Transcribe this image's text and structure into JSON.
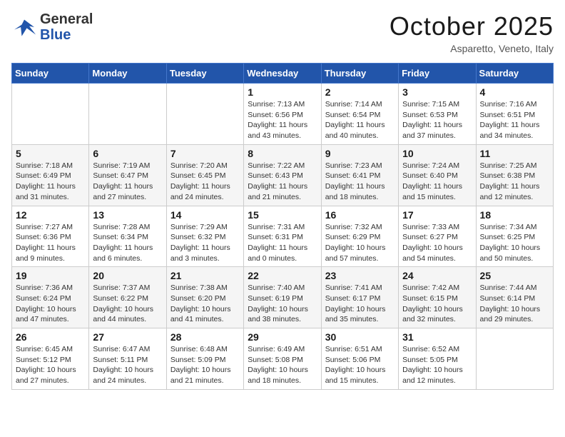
{
  "logo": {
    "general": "General",
    "blue": "Blue"
  },
  "title": "October 2025",
  "subtitle": "Asparetto, Veneto, Italy",
  "weekdays": [
    "Sunday",
    "Monday",
    "Tuesday",
    "Wednesday",
    "Thursday",
    "Friday",
    "Saturday"
  ],
  "weeks": [
    [
      {
        "day": "",
        "info": ""
      },
      {
        "day": "",
        "info": ""
      },
      {
        "day": "",
        "info": ""
      },
      {
        "day": "1",
        "info": "Sunrise: 7:13 AM\nSunset: 6:56 PM\nDaylight: 11 hours and 43 minutes."
      },
      {
        "day": "2",
        "info": "Sunrise: 7:14 AM\nSunset: 6:54 PM\nDaylight: 11 hours and 40 minutes."
      },
      {
        "day": "3",
        "info": "Sunrise: 7:15 AM\nSunset: 6:53 PM\nDaylight: 11 hours and 37 minutes."
      },
      {
        "day": "4",
        "info": "Sunrise: 7:16 AM\nSunset: 6:51 PM\nDaylight: 11 hours and 34 minutes."
      }
    ],
    [
      {
        "day": "5",
        "info": "Sunrise: 7:18 AM\nSunset: 6:49 PM\nDaylight: 11 hours and 31 minutes."
      },
      {
        "day": "6",
        "info": "Sunrise: 7:19 AM\nSunset: 6:47 PM\nDaylight: 11 hours and 27 minutes."
      },
      {
        "day": "7",
        "info": "Sunrise: 7:20 AM\nSunset: 6:45 PM\nDaylight: 11 hours and 24 minutes."
      },
      {
        "day": "8",
        "info": "Sunrise: 7:22 AM\nSunset: 6:43 PM\nDaylight: 11 hours and 21 minutes."
      },
      {
        "day": "9",
        "info": "Sunrise: 7:23 AM\nSunset: 6:41 PM\nDaylight: 11 hours and 18 minutes."
      },
      {
        "day": "10",
        "info": "Sunrise: 7:24 AM\nSunset: 6:40 PM\nDaylight: 11 hours and 15 minutes."
      },
      {
        "day": "11",
        "info": "Sunrise: 7:25 AM\nSunset: 6:38 PM\nDaylight: 11 hours and 12 minutes."
      }
    ],
    [
      {
        "day": "12",
        "info": "Sunrise: 7:27 AM\nSunset: 6:36 PM\nDaylight: 11 hours and 9 minutes."
      },
      {
        "day": "13",
        "info": "Sunrise: 7:28 AM\nSunset: 6:34 PM\nDaylight: 11 hours and 6 minutes."
      },
      {
        "day": "14",
        "info": "Sunrise: 7:29 AM\nSunset: 6:32 PM\nDaylight: 11 hours and 3 minutes."
      },
      {
        "day": "15",
        "info": "Sunrise: 7:31 AM\nSunset: 6:31 PM\nDaylight: 11 hours and 0 minutes."
      },
      {
        "day": "16",
        "info": "Sunrise: 7:32 AM\nSunset: 6:29 PM\nDaylight: 10 hours and 57 minutes."
      },
      {
        "day": "17",
        "info": "Sunrise: 7:33 AM\nSunset: 6:27 PM\nDaylight: 10 hours and 54 minutes."
      },
      {
        "day": "18",
        "info": "Sunrise: 7:34 AM\nSunset: 6:25 PM\nDaylight: 10 hours and 50 minutes."
      }
    ],
    [
      {
        "day": "19",
        "info": "Sunrise: 7:36 AM\nSunset: 6:24 PM\nDaylight: 10 hours and 47 minutes."
      },
      {
        "day": "20",
        "info": "Sunrise: 7:37 AM\nSunset: 6:22 PM\nDaylight: 10 hours and 44 minutes."
      },
      {
        "day": "21",
        "info": "Sunrise: 7:38 AM\nSunset: 6:20 PM\nDaylight: 10 hours and 41 minutes."
      },
      {
        "day": "22",
        "info": "Sunrise: 7:40 AM\nSunset: 6:19 PM\nDaylight: 10 hours and 38 minutes."
      },
      {
        "day": "23",
        "info": "Sunrise: 7:41 AM\nSunset: 6:17 PM\nDaylight: 10 hours and 35 minutes."
      },
      {
        "day": "24",
        "info": "Sunrise: 7:42 AM\nSunset: 6:15 PM\nDaylight: 10 hours and 32 minutes."
      },
      {
        "day": "25",
        "info": "Sunrise: 7:44 AM\nSunset: 6:14 PM\nDaylight: 10 hours and 29 minutes."
      }
    ],
    [
      {
        "day": "26",
        "info": "Sunrise: 6:45 AM\nSunset: 5:12 PM\nDaylight: 10 hours and 27 minutes."
      },
      {
        "day": "27",
        "info": "Sunrise: 6:47 AM\nSunset: 5:11 PM\nDaylight: 10 hours and 24 minutes."
      },
      {
        "day": "28",
        "info": "Sunrise: 6:48 AM\nSunset: 5:09 PM\nDaylight: 10 hours and 21 minutes."
      },
      {
        "day": "29",
        "info": "Sunrise: 6:49 AM\nSunset: 5:08 PM\nDaylight: 10 hours and 18 minutes."
      },
      {
        "day": "30",
        "info": "Sunrise: 6:51 AM\nSunset: 5:06 PM\nDaylight: 10 hours and 15 minutes."
      },
      {
        "day": "31",
        "info": "Sunrise: 6:52 AM\nSunset: 5:05 PM\nDaylight: 10 hours and 12 minutes."
      },
      {
        "day": "",
        "info": ""
      }
    ]
  ]
}
